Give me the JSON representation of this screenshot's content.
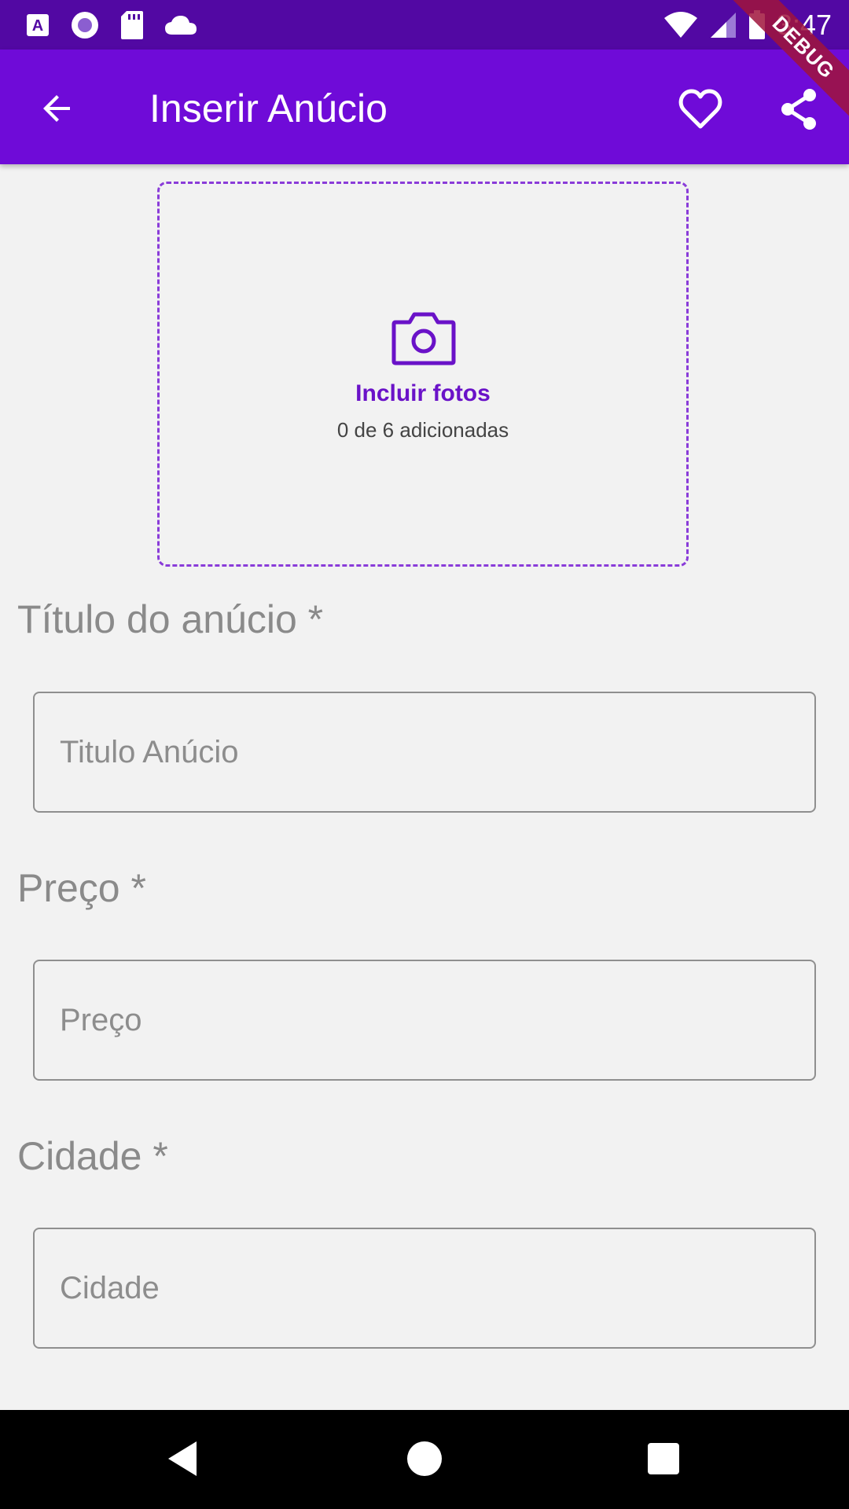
{
  "status_bar": {
    "time": "3:47",
    "icons": [
      "accessibility-icon",
      "radio-icon",
      "sd-card-icon",
      "cloud-icon",
      "wifi-icon",
      "cell-signal-icon",
      "battery-icon"
    ]
  },
  "app_bar": {
    "title": "Inserir Anúcio",
    "icons": [
      "arrow-back-icon",
      "heart-icon",
      "share-icon"
    ]
  },
  "debug_banner": "DEBUG",
  "photos": {
    "label": "Incluir fotos",
    "count_text": "0 de 6 adicionadas",
    "icon": "camera-icon"
  },
  "form": {
    "title": {
      "label": "Título do anúcio *",
      "placeholder": "Titulo Anúcio"
    },
    "price": {
      "label": "Preço *",
      "placeholder": "Preço"
    },
    "city": {
      "label": "Cidade *",
      "placeholder": "Cidade"
    }
  },
  "nav_bar": {
    "icons": [
      "nav-back-icon",
      "nav-home-icon",
      "nav-recents-icon"
    ]
  },
  "colors": {
    "status_bar": "#5208a3",
    "app_bar": "#6f0bd8",
    "accent": "#6a12c8",
    "background": "#f2f2f2"
  }
}
